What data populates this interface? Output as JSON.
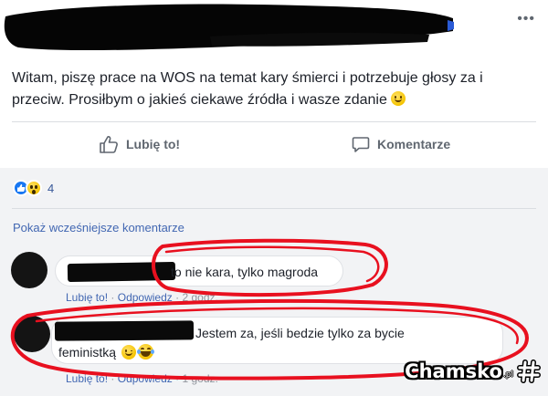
{
  "post": {
    "text": "Witam, piszę prace na WOS na temat kary śmierci i potrzebuje głosy za i przeciw. Prosiłbym o jakieś ciekawe źródła i wasze zdanie",
    "more_icon": "more-horizontal-icon"
  },
  "actions": {
    "like_label": "Lubię to!",
    "comment_label": "Komentarze"
  },
  "reactions": {
    "icons": [
      "like-reaction-icon",
      "wow-reaction-icon"
    ],
    "count": "4"
  },
  "comments_section": {
    "view_more_label": "Pokaż wcześniejsze komentarze",
    "comments": [
      {
        "text": "to nie kara, tylko magroda",
        "like_label": "Lubię to!",
        "separator": "·",
        "reply_label": "Odpowiedz",
        "time": "2 godz."
      },
      {
        "text_line1": "Jestem za, jeśli bedzie tylko za bycie",
        "text_line2": "feministką",
        "emojis": [
          "wink-emoji",
          "laughing-emoji"
        ],
        "like_label": "Lubię to!",
        "separator": "·",
        "reply_label": "Odpowiedz",
        "time": "1 godz."
      }
    ]
  },
  "watermark": {
    "brand": "Chamsko",
    "suffix": ".pl"
  },
  "colors": {
    "link": "#4267b2",
    "muted": "#90949c",
    "action_gray": "#606770",
    "annotation_red": "#e8101f",
    "comments_bg": "#f2f3f5"
  }
}
